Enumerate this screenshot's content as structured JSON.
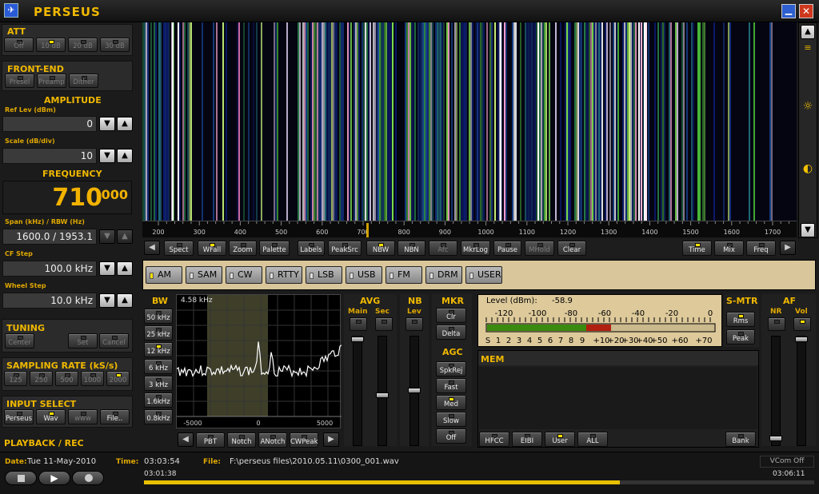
{
  "window": {
    "title": "PERSEUS"
  },
  "att": {
    "title": "ATT",
    "buttons": [
      {
        "label": "Off",
        "on": false
      },
      {
        "label": "10 dB",
        "on": true
      },
      {
        "label": "20 dB",
        "on": false
      },
      {
        "label": "30 dB",
        "on": false
      }
    ]
  },
  "frontend": {
    "title": "FRONT-END",
    "buttons": [
      {
        "label": "Presel",
        "on": false
      },
      {
        "label": "Preamp",
        "on": false
      },
      {
        "label": "Dither",
        "on": false
      }
    ]
  },
  "amplitude": {
    "title": "AMPLITUDE",
    "ref_label": "Ref Lev (dBm)",
    "ref_value": "0",
    "scale_label": "Scale (dB/div)",
    "scale_value": "10"
  },
  "frequency": {
    "title": "FREQUENCY",
    "main": "710",
    "sub": "000",
    "span_label": "Span (kHz) / RBW (Hz)",
    "span_value": "1600.0 / 1953.1",
    "cf_label": "CF Step",
    "cf_value": "100.0 kHz",
    "wheel_label": "Wheel Step",
    "wheel_value": "10.0 kHz"
  },
  "tuning": {
    "title": "TUNING",
    "buttons": [
      "Center",
      "Set",
      "Cancel"
    ]
  },
  "sampling": {
    "title": "SAMPLING RATE (kS/s)",
    "buttons": [
      {
        "label": "125",
        "on": false
      },
      {
        "label": "250",
        "on": false
      },
      {
        "label": "500",
        "on": false
      },
      {
        "label": "1000",
        "on": false
      },
      {
        "label": "2000",
        "on": true
      }
    ]
  },
  "input": {
    "title": "INPUT SELECT",
    "buttons": [
      {
        "label": "Perseus",
        "on": false
      },
      {
        "label": "Wav",
        "on": true
      },
      {
        "label": "www",
        "on": false
      },
      {
        "label": "File..",
        "on": false
      }
    ]
  },
  "playback": {
    "title": "PLAYBACK / REC"
  },
  "spectrum": {
    "freq_ticks": [
      "200",
      "300",
      "400",
      "500",
      "600",
      "700",
      "800",
      "900",
      "1000",
      "1100",
      "1200",
      "1300",
      "1400",
      "1500",
      "1600",
      "1700"
    ]
  },
  "toolbar": {
    "buttons": [
      {
        "label": "Spect",
        "on": false
      },
      {
        "label": "WFall",
        "on": true
      },
      {
        "label": "Zoom",
        "on": false
      },
      {
        "label": "Palette",
        "on": false
      },
      {
        "label": "Labels",
        "on": false
      },
      {
        "label": "PeakSrc",
        "on": false
      },
      {
        "label": "NBW",
        "on": true
      },
      {
        "label": "NBN",
        "on": false
      },
      {
        "label": "Afc",
        "on": false
      },
      {
        "label": "MkrLog",
        "on": false
      },
      {
        "label": "Pause",
        "on": false
      },
      {
        "label": "MHold",
        "on": false
      },
      {
        "label": "Clear",
        "on": false
      }
    ],
    "right_buttons": [
      {
        "label": "Time",
        "on": true
      },
      {
        "label": "Mix",
        "on": false
      },
      {
        "label": "Freq",
        "on": false
      }
    ]
  },
  "modes": [
    {
      "label": "AM",
      "on": true
    },
    {
      "label": "SAM",
      "on": false
    },
    {
      "label": "CW",
      "on": false
    },
    {
      "label": "RTTY",
      "on": false
    },
    {
      "label": "LSB",
      "on": false
    },
    {
      "label": "USB",
      "on": false
    },
    {
      "label": "FM",
      "on": false
    },
    {
      "label": "DRM",
      "on": false
    },
    {
      "label": "USER",
      "on": false
    }
  ],
  "bw": {
    "title": "BW",
    "buttons": [
      {
        "label": "50 kHz",
        "on": false
      },
      {
        "label": "25 kHz",
        "on": false
      },
      {
        "label": "12 kHz",
        "on": true
      },
      {
        "label": "6 kHz",
        "on": false
      },
      {
        "label": "3 kHz",
        "on": false
      },
      {
        "label": "1.6kHz",
        "on": false
      },
      {
        "label": "0.8kHz",
        "on": false
      }
    ],
    "readout": "4.58 kHz",
    "xticks": [
      "-5000",
      "0",
      "5000"
    ]
  },
  "filter_buttons": [
    "PBT",
    "Notch",
    "ANotch",
    "CWPeak"
  ],
  "avg": {
    "title": "AVG",
    "main": "Main",
    "sec": "Sec"
  },
  "nb": {
    "title": "NB",
    "lev": "Lev"
  },
  "mkr": {
    "title": "MKR",
    "buttons": [
      "Clr",
      "Delta"
    ]
  },
  "agc": {
    "title": "AGC",
    "buttons": [
      {
        "label": "SpkRej",
        "on": false
      },
      {
        "label": "Fast",
        "on": false
      },
      {
        "label": "Med",
        "on": true
      },
      {
        "label": "Slow",
        "on": false
      },
      {
        "label": "Off",
        "on": false
      }
    ]
  },
  "level": {
    "label": "Level (dBm):",
    "value": "-58.9",
    "scale_top": [
      "-120",
      "-100",
      "-80",
      "-60",
      "-40",
      "-20",
      "0"
    ],
    "scale_bottom": [
      "S",
      "1",
      "2",
      "3",
      "4",
      "5",
      "6",
      "7",
      "8",
      "9",
      "+10",
      "+20",
      "+30",
      "+40",
      "+50",
      "+60",
      "+70"
    ]
  },
  "smtr": {
    "title": "S-MTR",
    "buttons": [
      {
        "label": "Rms",
        "on": true
      },
      {
        "label": "Peak",
        "on": false
      }
    ]
  },
  "af": {
    "title": "AF",
    "nr": "NR",
    "vol": "Vol"
  },
  "mem": {
    "title": "MEM",
    "buttons": [
      {
        "label": "HFCC",
        "on": false
      },
      {
        "label": "EIBI",
        "on": false
      },
      {
        "label": "User",
        "on": true
      },
      {
        "label": "ALL",
        "on": false
      }
    ],
    "bank": "Bank"
  },
  "status": {
    "date_label": "Date:",
    "date": "Tue 11-May-2010",
    "time_label": "Time:",
    "time": "03:03:54",
    "file_label": "File:",
    "file": "F:\\perseus files\\2010.05.11\\0300_001.wav",
    "vcom": "VCom Off",
    "elapsed": "03:01:38",
    "total": "03:06:11",
    "progress": 0.71
  }
}
